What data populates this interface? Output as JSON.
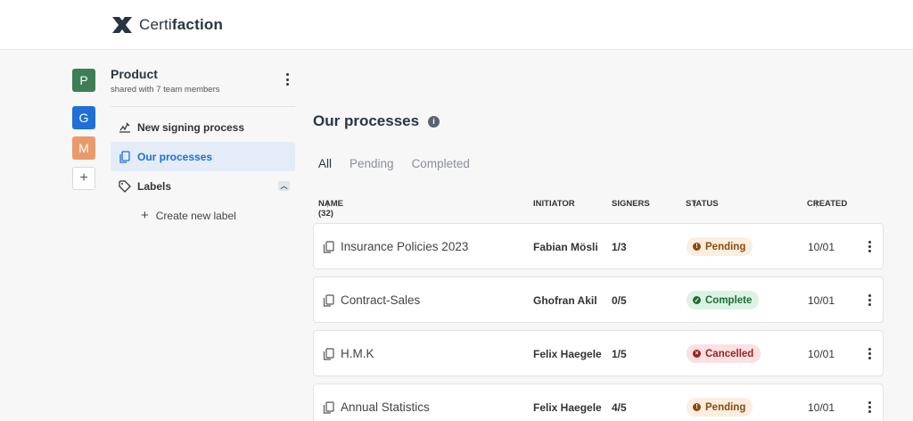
{
  "brand": {
    "prefix": "Certi",
    "suffix": "faction"
  },
  "workspaces": [
    {
      "letter": "P",
      "color": "#3e7e55"
    },
    {
      "letter": "G",
      "color": "#1f6fd8"
    },
    {
      "letter": "M",
      "color": "#e99a6b"
    },
    {
      "letter": "+"
    }
  ],
  "team": {
    "name": "Product",
    "subtitle": "shared with 7 team members"
  },
  "nav": {
    "new_signing": "New signing process",
    "our_processes": "Our processes",
    "labels": "Labels",
    "create_label": "Create new label"
  },
  "main": {
    "title": "Our processes",
    "tabs": [
      "All",
      "Pending",
      "Completed"
    ],
    "columns": {
      "name": "NAME (32)",
      "initiator": "INITIATOR",
      "signers": "SIGNERS",
      "status": "STATUS",
      "created": "CREATED"
    },
    "rows": [
      {
        "name": "Insurance Policies 2023",
        "initiator": "Fabian Mösli",
        "signers": "1/3",
        "status": "Pending",
        "created": "10/01"
      },
      {
        "name": "Contract-Sales",
        "initiator": "Ghofran Akil",
        "signers": "0/5",
        "status": "Complete",
        "created": "10/01"
      },
      {
        "name": "H.M.K",
        "initiator": "Felix Haegele",
        "signers": "1/5",
        "status": "Cancelled",
        "created": "10/01"
      },
      {
        "name": "Annual Statistics",
        "initiator": "Felix Haegele",
        "signers": "4/5",
        "status": "Pending",
        "created": "10/01"
      }
    ]
  },
  "colors": {
    "accent": "#1f6fd8",
    "pending": "#8a4a10",
    "complete": "#1d6b36",
    "cancelled": "#9a2020"
  }
}
